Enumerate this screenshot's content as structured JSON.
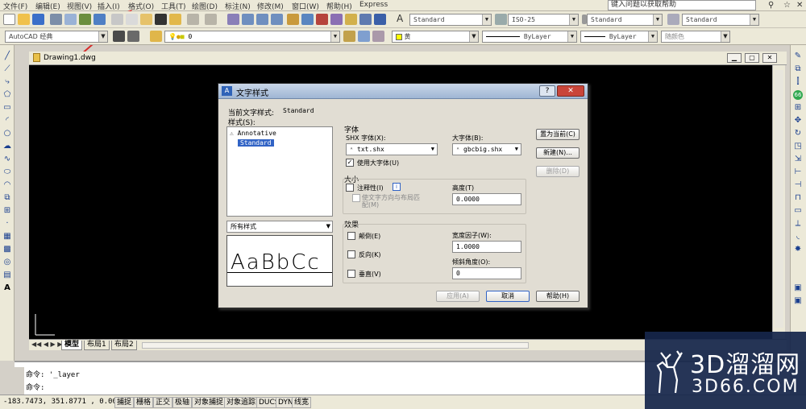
{
  "menubar": {
    "items": [
      "文件(F)",
      "编辑(E)",
      "视图(V)",
      "插入(I)",
      "格式(O)",
      "工具(T)",
      "绘图(D)",
      "标注(N)",
      "修改(M)",
      "窗口(W)",
      "帮助(H)",
      "Express"
    ],
    "help_search": "键入问题以获取帮助"
  },
  "toolbar1": {
    "text_style": "Standard",
    "dim_style": "ISO-25",
    "table_style": "Standard",
    "multileader_style": "Standard"
  },
  "toolbar2": {
    "workspace": "AutoCAD 经典",
    "layer": "0",
    "color": "黄",
    "linetype": "ByLayer",
    "lineweight": "ByLayer",
    "plotstyle": "随颜色"
  },
  "document": {
    "title": "Drawing1.dwg"
  },
  "tabs": [
    "模型",
    "布局1",
    "布局2"
  ],
  "command": {
    "line1": "命令: '_layer",
    "line2": "命令:"
  },
  "status": {
    "coords": "-183.7473, 351.8771 , 0.0000",
    "buttons": [
      "捕捉",
      "栅格",
      "正交",
      "极轴",
      "对象捕捉",
      "对象追踪",
      "DUCS",
      "DYN",
      "线宽"
    ]
  },
  "dialog": {
    "title": "文字样式",
    "current_style_label": "当前文字样式:",
    "current_style_value": "Standard",
    "styles_label": "样式(S):",
    "styles": [
      "Annotative",
      "Standard"
    ],
    "filter": "所有样式",
    "preview_text": "AaBbCc",
    "font_group": "字体",
    "shx_font_label": "SHX 字体(X):",
    "shx_font_value": "txt.shx",
    "big_font_label": "大字体(B):",
    "big_font_value": "gbcbig.shx",
    "use_big_font": "使用大字体(U)",
    "size_group": "大小",
    "annotative": "注释性(I)",
    "match_orientation": "使文字方向与布局匹配(M)",
    "height_label": "高度(T)",
    "height_value": "0.0000",
    "effects_group": "效果",
    "upside_down": "颠倒(E)",
    "backwards": "反向(K)",
    "vertical": "垂直(V)",
    "width_factor_label": "宽度因子(W):",
    "width_factor_value": "1.0000",
    "oblique_label": "倾斜角度(O):",
    "oblique_value": "0",
    "set_current": "置为当前(C)",
    "new": "新建(N)...",
    "delete": "删除(D)",
    "apply": "应用(A)",
    "cancel": "取消",
    "help": "帮助(H)"
  },
  "watermark": {
    "brand": "3D溜溜网",
    "url": "3D66.COM"
  },
  "colors": {
    "canvas": "#000000",
    "selection": "#3163c5",
    "annotation_arrow": "#d62a2a",
    "watermark": "#16264a"
  }
}
